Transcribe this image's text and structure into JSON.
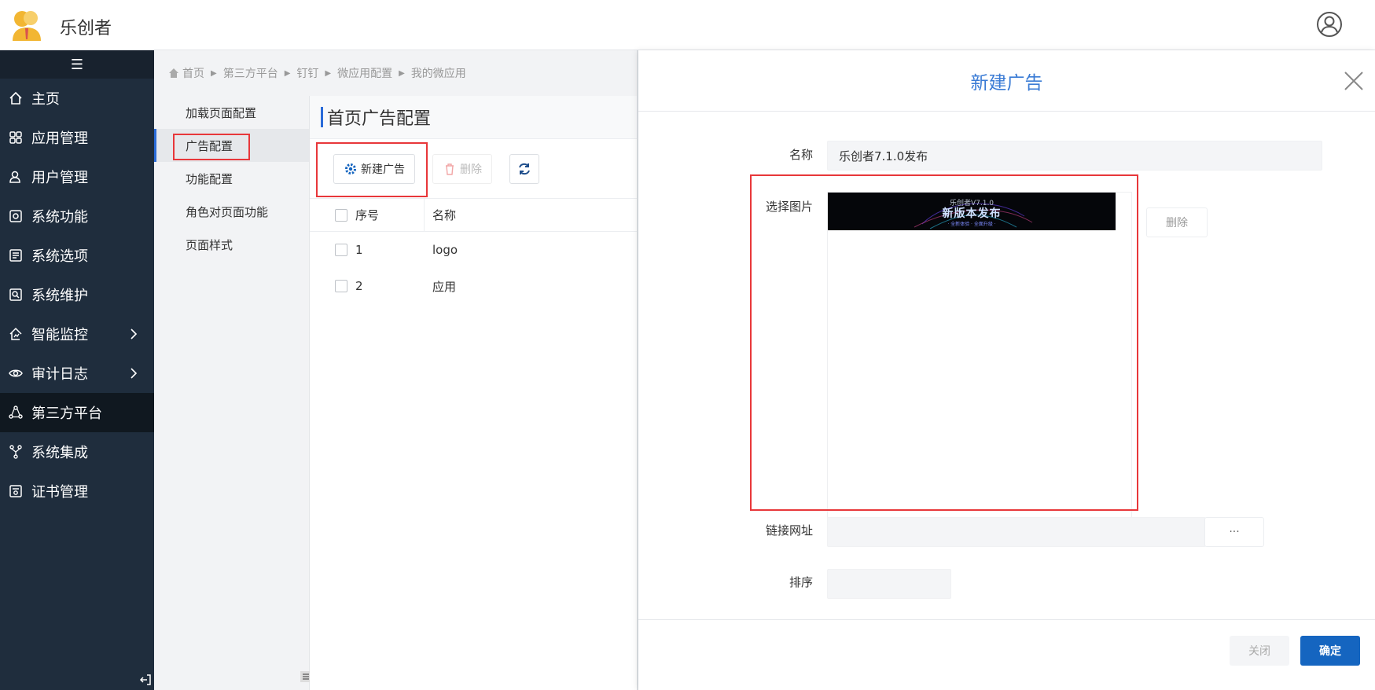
{
  "header": {
    "app_title": "乐创者"
  },
  "sidebar": {
    "toggle_glyph": "☰",
    "items": [
      {
        "label": "主页",
        "icon": "home-icon"
      },
      {
        "label": "应用管理",
        "icon": "apps-grid-icon"
      },
      {
        "label": "用户管理",
        "icon": "users-icon"
      },
      {
        "label": "系统功能",
        "icon": "system-function-icon"
      },
      {
        "label": "系统选项",
        "icon": "options-list-icon"
      },
      {
        "label": "系统维护",
        "icon": "maintenance-icon"
      },
      {
        "label": "智能监控",
        "icon": "monitor-icon",
        "has_children": true
      },
      {
        "label": "审计日志",
        "icon": "eye-icon",
        "has_children": true
      },
      {
        "label": "第三方平台",
        "icon": "third-party-icon",
        "active": true
      },
      {
        "label": "系统集成",
        "icon": "integration-icon"
      },
      {
        "label": "证书管理",
        "icon": "certificate-icon"
      }
    ]
  },
  "breadcrumb": [
    "首页",
    "第三方平台",
    "钉钉",
    "微应用配置",
    "我的微应用"
  ],
  "submenu": {
    "items": [
      "加载页面配置",
      "广告配置",
      "功能配置",
      "角色对页面功能",
      "页面样式"
    ],
    "active_index": 1
  },
  "content": {
    "title": "首页广告配置",
    "toolbar": {
      "new_label": "新建广告",
      "delete_label": "删除"
    },
    "table": {
      "columns": [
        "序号",
        "名称"
      ],
      "rows": [
        {
          "seq": "1",
          "name": "logo"
        },
        {
          "seq": "2",
          "name": "应用"
        }
      ]
    }
  },
  "drawer": {
    "title": "新建广告",
    "fields": {
      "name_label": "名称",
      "name_value": "乐创者7.1.0发布",
      "image_label": "选择图片",
      "image_delete_label": "删除",
      "banner": {
        "top_text": "乐创者V7.1.0",
        "main_text": "新版本发布",
        "sub_text": "· 全新体验 · 全面升级 ·"
      },
      "link_label": "链接网址",
      "link_value": "",
      "link_button": "···",
      "order_label": "排序",
      "order_value": ""
    },
    "footer": {
      "close_label": "关闭",
      "ok_label": "确定"
    }
  },
  "colors": {
    "sidebar_bg": "#1f2d3d",
    "accent": "#2a6bd8",
    "primary_button": "#1565c0",
    "highlight_box": "#e8373a"
  }
}
